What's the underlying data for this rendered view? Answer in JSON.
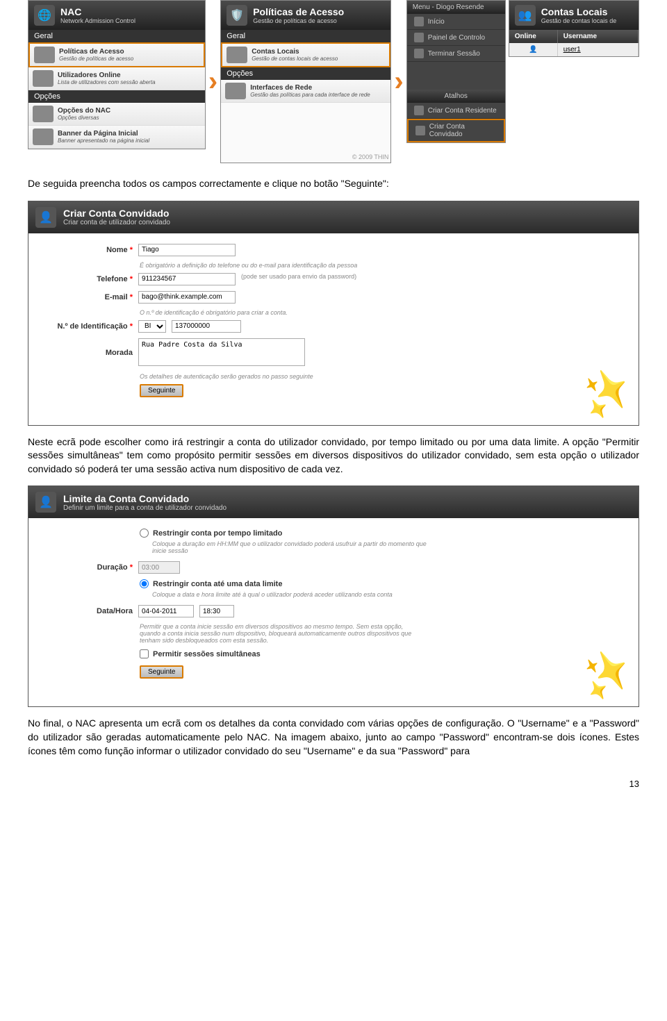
{
  "top_panels": {
    "nac": {
      "title": "NAC",
      "sub": "Network Admission Control",
      "sec_geral": "Geral",
      "sec_opcoes": "Opções",
      "items": [
        {
          "t1": "Políticas de Acesso",
          "t2": "Gestão de políticas de acesso",
          "hl": true
        },
        {
          "t1": "Utilizadores Online",
          "t2": "Lista de utilizadores com sessão aberta",
          "hl": false
        }
      ],
      "opcoes_items": [
        {
          "t1": "Opções do NAC",
          "t2": "Opções diversas"
        },
        {
          "t1": "Banner da Página Inicial",
          "t2": "Banner apresentado na página inicial"
        }
      ]
    },
    "politicas": {
      "title": "Políticas de Acesso",
      "sub": "Gestão de políticas de acesso",
      "sec_geral": "Geral",
      "sec_opcoes": "Opções",
      "items": [
        {
          "t1": "Contas Locais",
          "t2": "Gestão de contas locais de acesso",
          "hl": true
        }
      ],
      "opcoes_items": [
        {
          "t1": "Interfaces de Rede",
          "t2": "Gestão das políticas para cada interface de rede"
        }
      ],
      "copy": "© 2009 THIN"
    },
    "menu": {
      "header": "Menu - Diogo Resende",
      "items": [
        "Início",
        "Painel de Controlo",
        "Terminar Sessão"
      ],
      "atalhos_hd": "Atalhos",
      "atalhos": [
        {
          "label": "Criar Conta Residente",
          "hl": false
        },
        {
          "label": "Criar Conta Convidado",
          "hl": true
        }
      ]
    },
    "contas": {
      "title": "Contas Locais",
      "sub": "Gestão de contas locais de",
      "th_online": "Online",
      "th_user": "Username",
      "row_user": "user1"
    }
  },
  "para1": "De seguida preencha todos os campos correctamente e clique no botão \"Seguinte\":",
  "form1": {
    "header_title": "Criar Conta Convidado",
    "header_sub": "Criar conta de utilizador convidado",
    "nome_label": "Nome",
    "nome_val": "Tiago",
    "nome_note": "É obrigatório a definição do telefone ou do e-mail para identificação da pessoa",
    "tel_label": "Telefone",
    "tel_val": "911234567",
    "tel_note": "(pode ser usado para envio da password)",
    "email_label": "E-mail",
    "email_val": "bago@think.example.com",
    "email_note": "O n.º de identificação é obrigatório para criar a conta.",
    "id_label": "N.º de Identificação",
    "id_sel": "BI",
    "id_val": "137000000",
    "morada_label": "Morada",
    "morada_val": "Rua Padre Costa da Silva",
    "foot_note": "Os detalhes de autenticação serão gerados no passo seguinte",
    "btn": "Seguinte"
  },
  "para2": "Neste ecrã pode escolher como irá restringir a conta do utilizador convidado, por tempo limitado ou por uma data limite. A opção \"Permitir sessões simultâneas\" tem como propósito permitir sessões em diversos dispositivos do utilizador convidado, sem esta opção o utilizador convidado só poderá ter uma sessão activa num dispositivo de cada vez.",
  "form2": {
    "header_title": "Limite da Conta Convidado",
    "header_sub": "Definir um limite para a conta de utilizador convidado",
    "r1_label": "Restringir conta por tempo limitado",
    "r1_note": "Coloque a duração em HH:MM que o utilizador convidado poderá usufruir a partir do momento que inicie sessão",
    "dur_label": "Duração",
    "dur_val": "03:00",
    "r2_label": "Restringir conta até uma data limite",
    "r2_note": "Coloque a data e hora limite até à qual o utilizador poderá aceder utilizando esta conta",
    "dh_label": "Data/Hora",
    "dh_date": "04-04-2011",
    "dh_time": "18:30",
    "dh_note": "Permitir que a conta inicie sessão em diversos dispositivos ao mesmo tempo. Sem esta opção, quando a conta inicia sessão num dispositivo, bloqueará automaticamente outros dispositivos que tenham sido desbloqueados com esta sessão.",
    "chk_label": "Permitir sessões simultâneas",
    "btn": "Seguinte"
  },
  "para3": "No final, o NAC apresenta um ecrã com os detalhes da conta convidado com várias opções de configuração. O \"Username\" e a \"Password\" do utilizador são geradas automaticamente pelo NAC. Na imagem abaixo, junto ao campo \"Password\" encontram-se dois ícones. Estes ícones têm como função informar o utilizador convidado do seu \"Username\" e da sua \"Password\" para",
  "page": "13"
}
